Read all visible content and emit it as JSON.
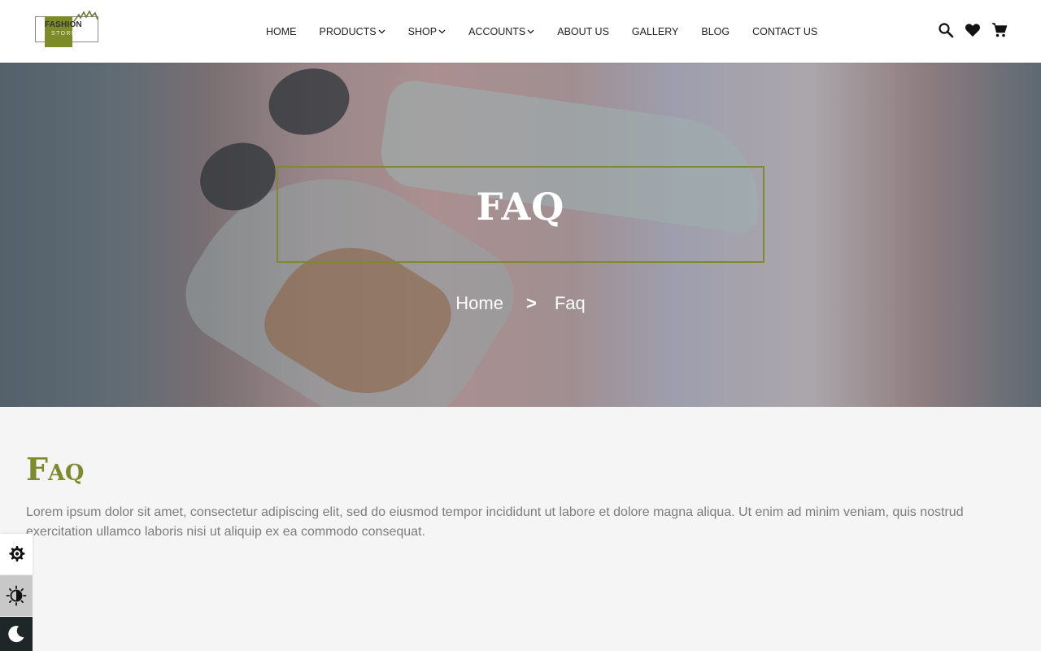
{
  "logo": {
    "line1": "FASHION",
    "line2": "STORE",
    "brand_color": "#7d8b2a"
  },
  "nav": {
    "items": [
      {
        "label": "HOME",
        "has_dropdown": false
      },
      {
        "label": "PRODUCTS",
        "has_dropdown": true
      },
      {
        "label": "SHOP",
        "has_dropdown": true
      },
      {
        "label": "ACCOUNTS",
        "has_dropdown": true
      },
      {
        "label": "ABOUT US",
        "has_dropdown": false
      },
      {
        "label": "GALLERY",
        "has_dropdown": false
      },
      {
        "label": "BLOG",
        "has_dropdown": false
      },
      {
        "label": "CONTACT US",
        "has_dropdown": false
      }
    ]
  },
  "header_icons": [
    "search-icon",
    "heart-icon",
    "cart-icon"
  ],
  "hero": {
    "title": "FAQ",
    "breadcrumb": {
      "home": "Home",
      "separator": ">",
      "current": "Faq"
    },
    "accent_color": "#7f8a2e"
  },
  "content": {
    "title": "Faq",
    "text": "Lorem ipsum dolor sit amet, consectetur adipiscing elit, sed do eiusmod tempor incididunt ut labore et dolore magna aliqua. Ut enim ad minim veniam, quis nostrud exercitation ullamco laboris nisi ut aliquip ex ea commodo consequat."
  },
  "side_widgets": [
    "settings-icon",
    "brightness-icon",
    "dark-mode-icon"
  ]
}
